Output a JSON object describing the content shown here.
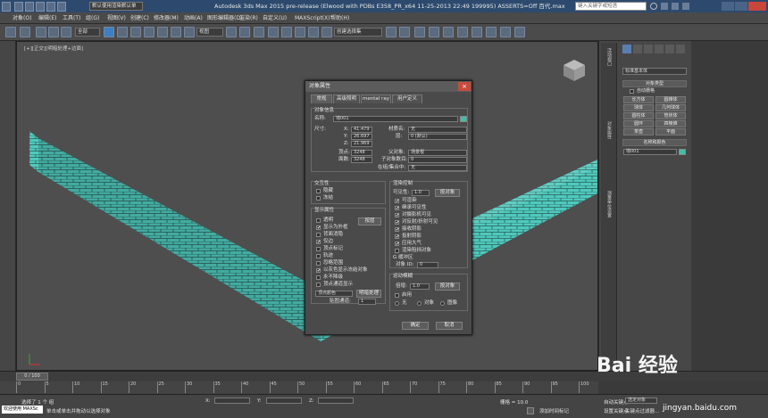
{
  "window": {
    "title": "Autodesk 3ds Max  2015 pre-release (Elwood with PDBs E358_PR_x64 11-25-2013 22:49 199995) ASSERTS=Off    百代.max",
    "project": "默认使用渲染默认单",
    "search_placeholder": "键入关键字或短语"
  },
  "menus": [
    "对象(O)",
    "编辑(E)",
    "工具(T)",
    "组(G)",
    "视图(V)",
    "创建(C)",
    "修改器(M)",
    "动画(A)",
    "图形编辑器(D)",
    "渲染(R)",
    "自定义(U)",
    "MAXScript(X)",
    "帮助(H)"
  ],
  "toolbar": {
    "filter": "全部",
    "view": "视图",
    "selection_set": "创建选择集"
  },
  "viewport": {
    "label": "[+][正交][明暗处理+边面]"
  },
  "command_panel": {
    "category": "标准基本体",
    "object_type_title": "对象类型",
    "autogrid": "自动栅格",
    "buttons": [
      "长方体",
      "圆锥体",
      "球体",
      "几何球体",
      "圆柱体",
      "管状体",
      "圆环",
      "四棱锥",
      "茶壶",
      "平面"
    ],
    "name_color_title": "名称和颜色",
    "object_name": "墙001"
  },
  "right_vertical": [
    "活动视口",
    "对象属性",
    "测量单位设置",
    "图纸编辑"
  ],
  "dialog": {
    "title": "对象属性",
    "close": "×",
    "tabs": [
      "常规",
      "高级照明",
      "mental ray",
      "用户定义"
    ],
    "info": {
      "title": "对象信息",
      "name_label": "名称:",
      "name": "墙001",
      "dims_label": "尺寸:",
      "x_label": "X:",
      "x": "41.479",
      "y_label": "Y:",
      "y": "26.697",
      "z_label": "Z:",
      "z": "21.969",
      "verts_label": "顶点:",
      "verts": "3248",
      "faces_label": "面数:",
      "faces": "3248",
      "material_label": "材质名:",
      "material": "无",
      "layer_label": "层:",
      "layer": "0 (默认)",
      "parent_label": "父对象:",
      "parent": "场景根",
      "children_label": "子对象数目:",
      "children": "0",
      "group_label": "在组/集合中:",
      "group": "无"
    },
    "interaction": {
      "title": "交互性",
      "hide": "隐藏",
      "freeze": "冻结"
    },
    "display": {
      "title": "显示属性",
      "by_layer": "按层",
      "items": [
        "透明",
        "显示为外框",
        "背面消隐",
        "仅边",
        "顶点标记",
        "轨迹",
        "忽略范围",
        "以灰色显示冻结对象",
        "永不降级",
        "顶点通道显示"
      ],
      "checked": [
        false,
        true,
        false,
        true,
        false,
        false,
        false,
        true,
        false,
        false
      ],
      "channel": "顶点颜色",
      "shaded": "明暗处理",
      "map_label": "贴图通道:",
      "map_value": "1"
    },
    "render": {
      "title": "渲染控制",
      "visibility_label": "可见性:",
      "visibility": "1.0",
      "by_object": "按对象",
      "items": [
        "可渲染",
        "继承可见性",
        "对摄影机可见",
        "对反射/折射可见",
        "接收阴影",
        "投射阴影",
        "应用大气",
        "渲染阻挡对象"
      ],
      "checked": [
        true,
        true,
        true,
        true,
        true,
        true,
        true,
        false
      ],
      "gbuffer": "G 缓冲区",
      "obj_id_label": "对象 ID:",
      "obj_id": "0"
    },
    "motion_blur": {
      "title": "运动模糊",
      "multiplier_label": "倍增:",
      "multiplier": "1.0",
      "enabled": "启用",
      "options": [
        "无",
        "对象",
        "图像"
      ]
    },
    "ok": "确定",
    "cancel": "取消"
  },
  "timeline": {
    "frame": "0 / 100"
  },
  "ruler_ticks": [
    "0",
    "5",
    "10",
    "15",
    "20",
    "25",
    "30",
    "35",
    "40",
    "45",
    "50",
    "55",
    "60",
    "65",
    "70",
    "75",
    "80",
    "85",
    "90",
    "95",
    "100"
  ],
  "status": {
    "selection": "选择了 1 个 组",
    "hint": "单击或单击并拖动以选择对象",
    "welcome": "欢迎使用 MAXSc",
    "x": "X:",
    "y": "Y:",
    "z": "Z:",
    "grid": "栅格 = 10.0",
    "autokey": "自动关键点",
    "selected": "选定对象",
    "add_time_tag": "添加时间标记",
    "setkey": "设置关键点",
    "filter": "关键点过滤器..."
  },
  "watermark": {
    "text": "Bai  经验",
    "url": "jingyan.baidu.com"
  }
}
